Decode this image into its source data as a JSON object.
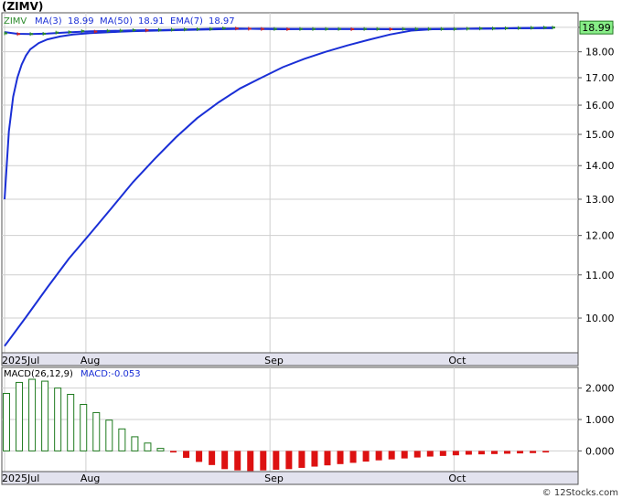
{
  "title": "(ZIMV)",
  "footer": "© 12Stocks.com",
  "colors": {
    "price_up": "#2a8a2a",
    "price_down": "#cc2222",
    "ma": "#1a2fd6",
    "grid": "#cfcfcf",
    "axis_band": "#e2e2ee",
    "label_box": "#88ee88",
    "hist_pos_stroke": "#1e7a1e",
    "hist_neg": "#dd1111"
  },
  "chart_data": [
    {
      "type": "line",
      "legend": [
        {
          "label": "ZIMV",
          "color": "#2a8a2a"
        },
        {
          "label": "MA(3)",
          "value": "18.99",
          "color": "#1a2fd6"
        },
        {
          "label": "MA(50)",
          "value": "18.91",
          "color": "#1a2fd6"
        },
        {
          "label": "EMA(7)",
          "value": "18.97",
          "color": "#1a2fd6"
        }
      ],
      "last_price_label": "18.99",
      "yscale": "log",
      "ylim": [
        9.3,
        19.5
      ],
      "yticks": [
        "10.00",
        "11.00",
        "12.00",
        "13.00",
        "14.00",
        "15.00",
        "16.00",
        "17.00",
        "18.00",
        "19.00"
      ],
      "xticks": [
        "2025Jul",
        "Aug",
        "Sep",
        "Oct"
      ],
      "xtick_days": [
        0,
        19,
        62,
        105
      ],
      "days_total": 129,
      "grid": true,
      "series": [
        {
          "name": "ZIMV",
          "style": "price",
          "points": [
            [
              0,
              18.75
            ],
            [
              3,
              18.72
            ],
            [
              6,
              18.72
            ],
            [
              9,
              18.73
            ],
            [
              12,
              18.78
            ],
            [
              15,
              18.8
            ],
            [
              18,
              18.84
            ],
            [
              21,
              18.82
            ],
            [
              24,
              18.85
            ],
            [
              27,
              18.86
            ],
            [
              30,
              18.88
            ],
            [
              33,
              18.87
            ],
            [
              36,
              18.89
            ],
            [
              39,
              18.9
            ],
            [
              42,
              18.91
            ],
            [
              45,
              18.92
            ],
            [
              48,
              18.93
            ],
            [
              51,
              18.96
            ],
            [
              54,
              18.95
            ],
            [
              57,
              18.94
            ],
            [
              60,
              18.93
            ],
            [
              63,
              18.93
            ],
            [
              66,
              18.92
            ],
            [
              69,
              18.93
            ],
            [
              72,
              18.93
            ],
            [
              75,
              18.93
            ],
            [
              78,
              18.93
            ],
            [
              81,
              18.92
            ],
            [
              84,
              18.93
            ],
            [
              87,
              18.93
            ],
            [
              90,
              18.92
            ],
            [
              93,
              18.93
            ],
            [
              96,
              18.93
            ],
            [
              99,
              18.93
            ],
            [
              102,
              18.93
            ],
            [
              105,
              18.93
            ],
            [
              108,
              18.94
            ],
            [
              111,
              18.95
            ],
            [
              114,
              18.95
            ],
            [
              117,
              18.96
            ],
            [
              120,
              18.97
            ],
            [
              123,
              18.98
            ],
            [
              126,
              18.99
            ],
            [
              128,
              18.99
            ]
          ]
        },
        {
          "name": "MA(3)",
          "points": [
            [
              0,
              18.8
            ],
            [
              3,
              18.73
            ],
            [
              6,
              18.72
            ],
            [
              10,
              18.74
            ],
            [
              15,
              18.79
            ],
            [
              20,
              18.83
            ],
            [
              25,
              18.85
            ],
            [
              30,
              18.87
            ],
            [
              35,
              18.88
            ],
            [
              40,
              18.9
            ],
            [
              45,
              18.92
            ],
            [
              50,
              18.95
            ],
            [
              55,
              18.95
            ],
            [
              60,
              18.93
            ],
            [
              65,
              18.92
            ],
            [
              70,
              18.93
            ],
            [
              80,
              18.93
            ],
            [
              90,
              18.92
            ],
            [
              100,
              18.93
            ],
            [
              110,
              18.94
            ],
            [
              120,
              18.97
            ],
            [
              128,
              18.99
            ]
          ]
        },
        {
          "name": "MA(50)",
          "points": [
            [
              0,
              9.4
            ],
            [
              5,
              10.02
            ],
            [
              10,
              10.7
            ],
            [
              15,
              11.4
            ],
            [
              20,
              12.05
            ],
            [
              25,
              12.75
            ],
            [
              30,
              13.5
            ],
            [
              35,
              14.2
            ],
            [
              40,
              14.9
            ],
            [
              45,
              15.55
            ],
            [
              50,
              16.1
            ],
            [
              55,
              16.6
            ],
            [
              60,
              17.0
            ],
            [
              65,
              17.4
            ],
            [
              70,
              17.72
            ],
            [
              75,
              18.0
            ],
            [
              80,
              18.25
            ],
            [
              85,
              18.48
            ],
            [
              90,
              18.7
            ],
            [
              95,
              18.86
            ],
            [
              100,
              18.92
            ],
            [
              105,
              18.93
            ],
            [
              110,
              18.94
            ],
            [
              115,
              18.95
            ],
            [
              120,
              18.96
            ],
            [
              128,
              18.97
            ]
          ]
        },
        {
          "name": "EMA(7)",
          "points": [
            [
              0,
              13.0
            ],
            [
              1,
              15.1
            ],
            [
              2,
              16.3
            ],
            [
              3,
              17.0
            ],
            [
              4,
              17.5
            ],
            [
              5,
              17.85
            ],
            [
              6,
              18.1
            ],
            [
              8,
              18.35
            ],
            [
              10,
              18.5
            ],
            [
              13,
              18.62
            ],
            [
              16,
              18.7
            ],
            [
              20,
              18.76
            ],
            [
              25,
              18.8
            ],
            [
              30,
              18.84
            ],
            [
              40,
              18.88
            ],
            [
              50,
              18.92
            ],
            [
              60,
              18.94
            ],
            [
              70,
              18.93
            ],
            [
              80,
              18.93
            ],
            [
              90,
              18.93
            ],
            [
              100,
              18.93
            ],
            [
              110,
              18.94
            ],
            [
              120,
              18.96
            ],
            [
              128,
              18.97
            ]
          ]
        }
      ]
    },
    {
      "type": "bar",
      "label": "MACD(26,12,9)",
      "macd_label": "MACD:-0.053",
      "ylim": [
        -0.6,
        2.6
      ],
      "yticks": [
        "0.000",
        "1.000",
        "2.000"
      ],
      "xticks": [
        "2025Jul",
        "Aug",
        "Sep",
        "Oct"
      ],
      "days": [
        0,
        3,
        6,
        9,
        12,
        15,
        18,
        21,
        24,
        27,
        30,
        33,
        36,
        39,
        42,
        45,
        48,
        51,
        54,
        57,
        60,
        63,
        66,
        69,
        72,
        75,
        78,
        81,
        84,
        87,
        90,
        93,
        96,
        99,
        102,
        105,
        108,
        111,
        114,
        117,
        120,
        123,
        126
      ],
      "values": [
        1.83,
        2.18,
        2.28,
        2.22,
        2.0,
        1.8,
        1.48,
        1.22,
        0.98,
        0.7,
        0.45,
        0.25,
        0.08,
        -0.05,
        -0.22,
        -0.35,
        -0.45,
        -0.58,
        -0.62,
        -0.64,
        -0.62,
        -0.6,
        -0.58,
        -0.54,
        -0.5,
        -0.46,
        -0.42,
        -0.38,
        -0.34,
        -0.3,
        -0.27,
        -0.24,
        -0.21,
        -0.18,
        -0.16,
        -0.14,
        -0.12,
        -0.11,
        -0.1,
        -0.09,
        -0.08,
        -0.07,
        -0.05
      ]
    }
  ]
}
